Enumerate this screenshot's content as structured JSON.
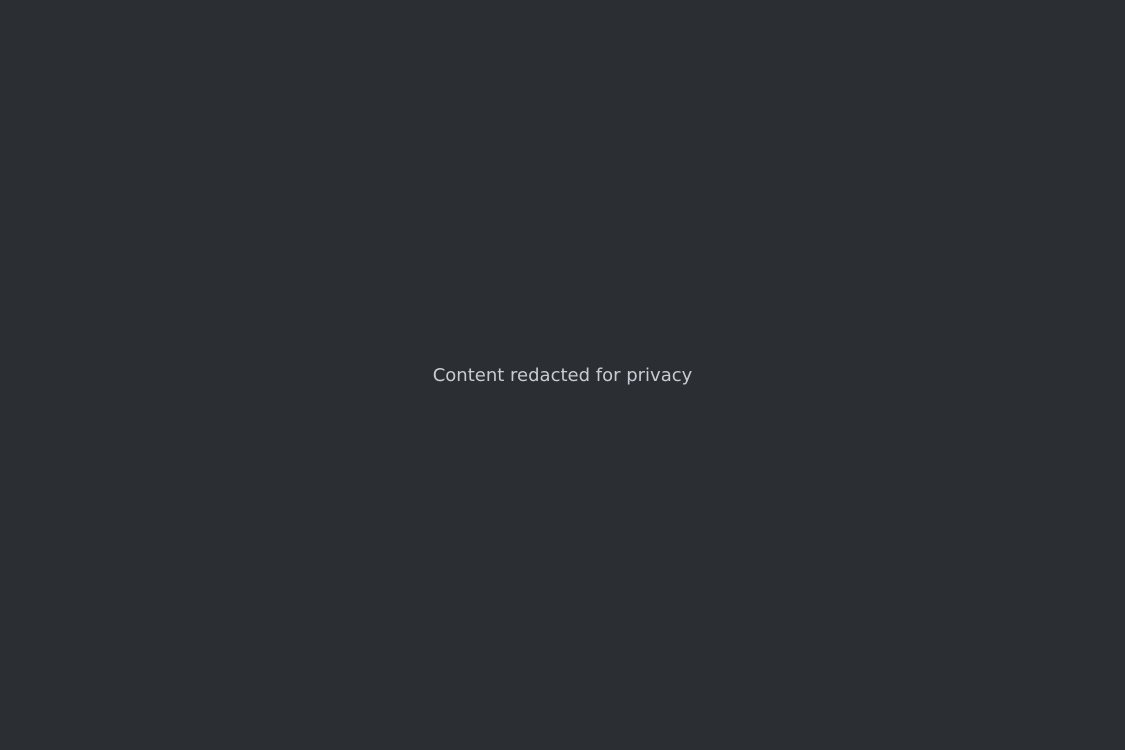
{
  "notice": "Content redacted for privacy"
}
